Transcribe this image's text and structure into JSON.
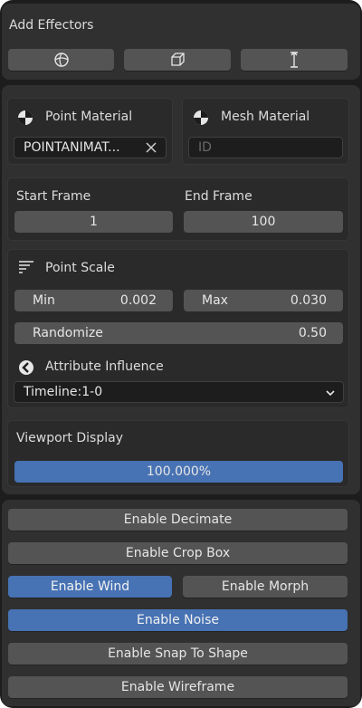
{
  "add_effectors": {
    "title": "Add Effectors",
    "buttons": [
      {
        "icon": "sphere-effector-icon"
      },
      {
        "icon": "cube-effector-icon"
      },
      {
        "icon": "arrow-effector-icon"
      }
    ]
  },
  "materials": {
    "point_label": "Point Material",
    "point_value": "POINTANIMAT...",
    "mesh_label": "Mesh Material",
    "mesh_placeholder": "ID"
  },
  "frames": {
    "start_label": "Start Frame",
    "start_value": "1",
    "end_label": "End Frame",
    "end_value": "100"
  },
  "point_scale": {
    "label": "Point Scale",
    "min_label": "Min",
    "min_value": "0.002",
    "max_label": "Max",
    "max_value": "0.030",
    "randomize_label": "Randomize",
    "randomize_value": "0.50",
    "attribute_label": "Attribute Influence",
    "attribute_value": "Timeline:1-0"
  },
  "viewport": {
    "label": "Viewport Display",
    "value": "100.000%",
    "fill_fraction": 1.0
  },
  "toggles": {
    "decimate": "Enable Decimate",
    "crop_box": "Enable Crop Box",
    "wind": "Enable Wind",
    "morph": "Enable Morph",
    "noise": "Enable Noise",
    "snap": "Enable Snap To Shape",
    "wireframe": "Enable Wireframe"
  },
  "colors": {
    "accent": "#4772b3",
    "button": "#545454",
    "panel": "#303030",
    "background": "#1d1d1d"
  }
}
